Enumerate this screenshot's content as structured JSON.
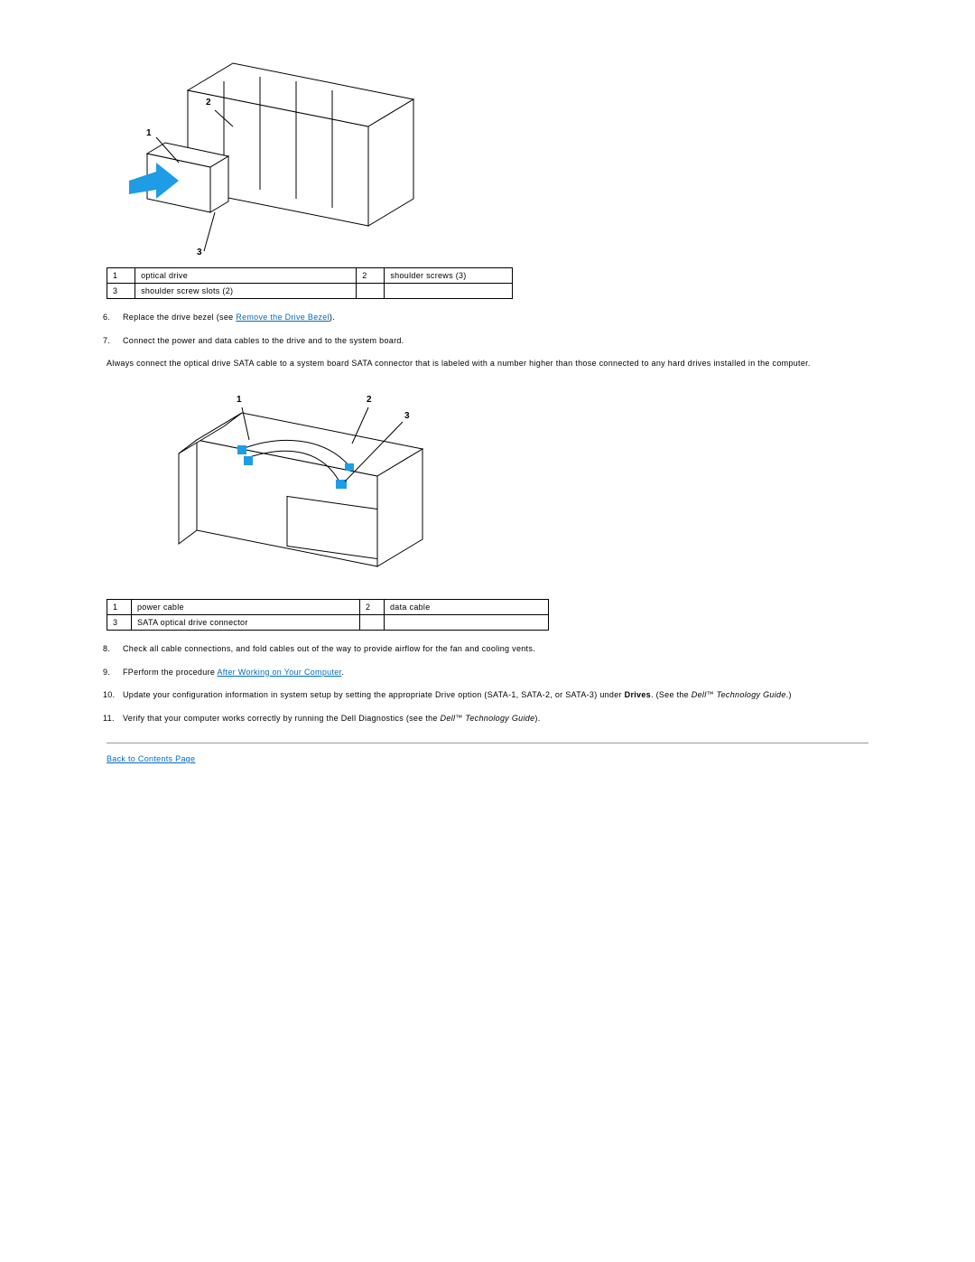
{
  "figure1": {
    "callout1": "1",
    "callout2": "2",
    "callout3": "3",
    "table": {
      "r1c1": "1",
      "r1c2": "optical drive",
      "r1c3": "2",
      "r1c4": "shoulder screws (3)",
      "r2c1": "3",
      "r2c2": "shoulder screw slots (2)",
      "r2c3": "",
      "r2c4": ""
    }
  },
  "steps": {
    "s6num": "6.",
    "s6pre": "Replace the drive bezel (see ",
    "s6link": "Remove the Drive Bezel",
    "s6post": ").",
    "s7num": "7.",
    "s7": "Connect the power and data cables to the drive and to the system board.",
    "sata_note": "Always connect the optical drive SATA cable to a system board SATA connector that is labeled with a number higher than those connected to any hard drives installed in the computer.",
    "s8num": "8.",
    "s8": "Check all cable connections, and fold cables out of the way to provide airflow for the fan and cooling vents.",
    "s9num": "9.",
    "s9pre": "FPerform the procedure ",
    "s9link": "After Working on Your Computer",
    "s9post": ".",
    "s10num": "10.",
    "s10pre": "Update your configuration information in system setup by setting the appropriate Drive option (SATA-1, SATA-2, or SATA-3) under ",
    "s10bold": "Drives",
    "s10mid": ". (See the ",
    "s10em": "Dell",
    "s10tm": "™",
    "s10em2": " Technology Guide",
    "s10post": ".)",
    "s11num": "11.",
    "s11pre": "Verify that your computer works correctly by running the Dell Diagnostics (see the ",
    "s11em": "Dell",
    "s11tm": "™",
    "s11em2": " Technology Guide",
    "s11post": ")."
  },
  "figure2": {
    "callout1": "1",
    "callout2": "2",
    "callout3": "3",
    "table": {
      "r1c1": "1",
      "r1c2": "power cable",
      "r1c3": "2",
      "r1c4": "data cable",
      "r2c1": "3",
      "r2c2": "SATA optical drive connector",
      "r2c3": "",
      "r2c4": ""
    }
  },
  "footer": {
    "back": "Back to Contents Page"
  }
}
